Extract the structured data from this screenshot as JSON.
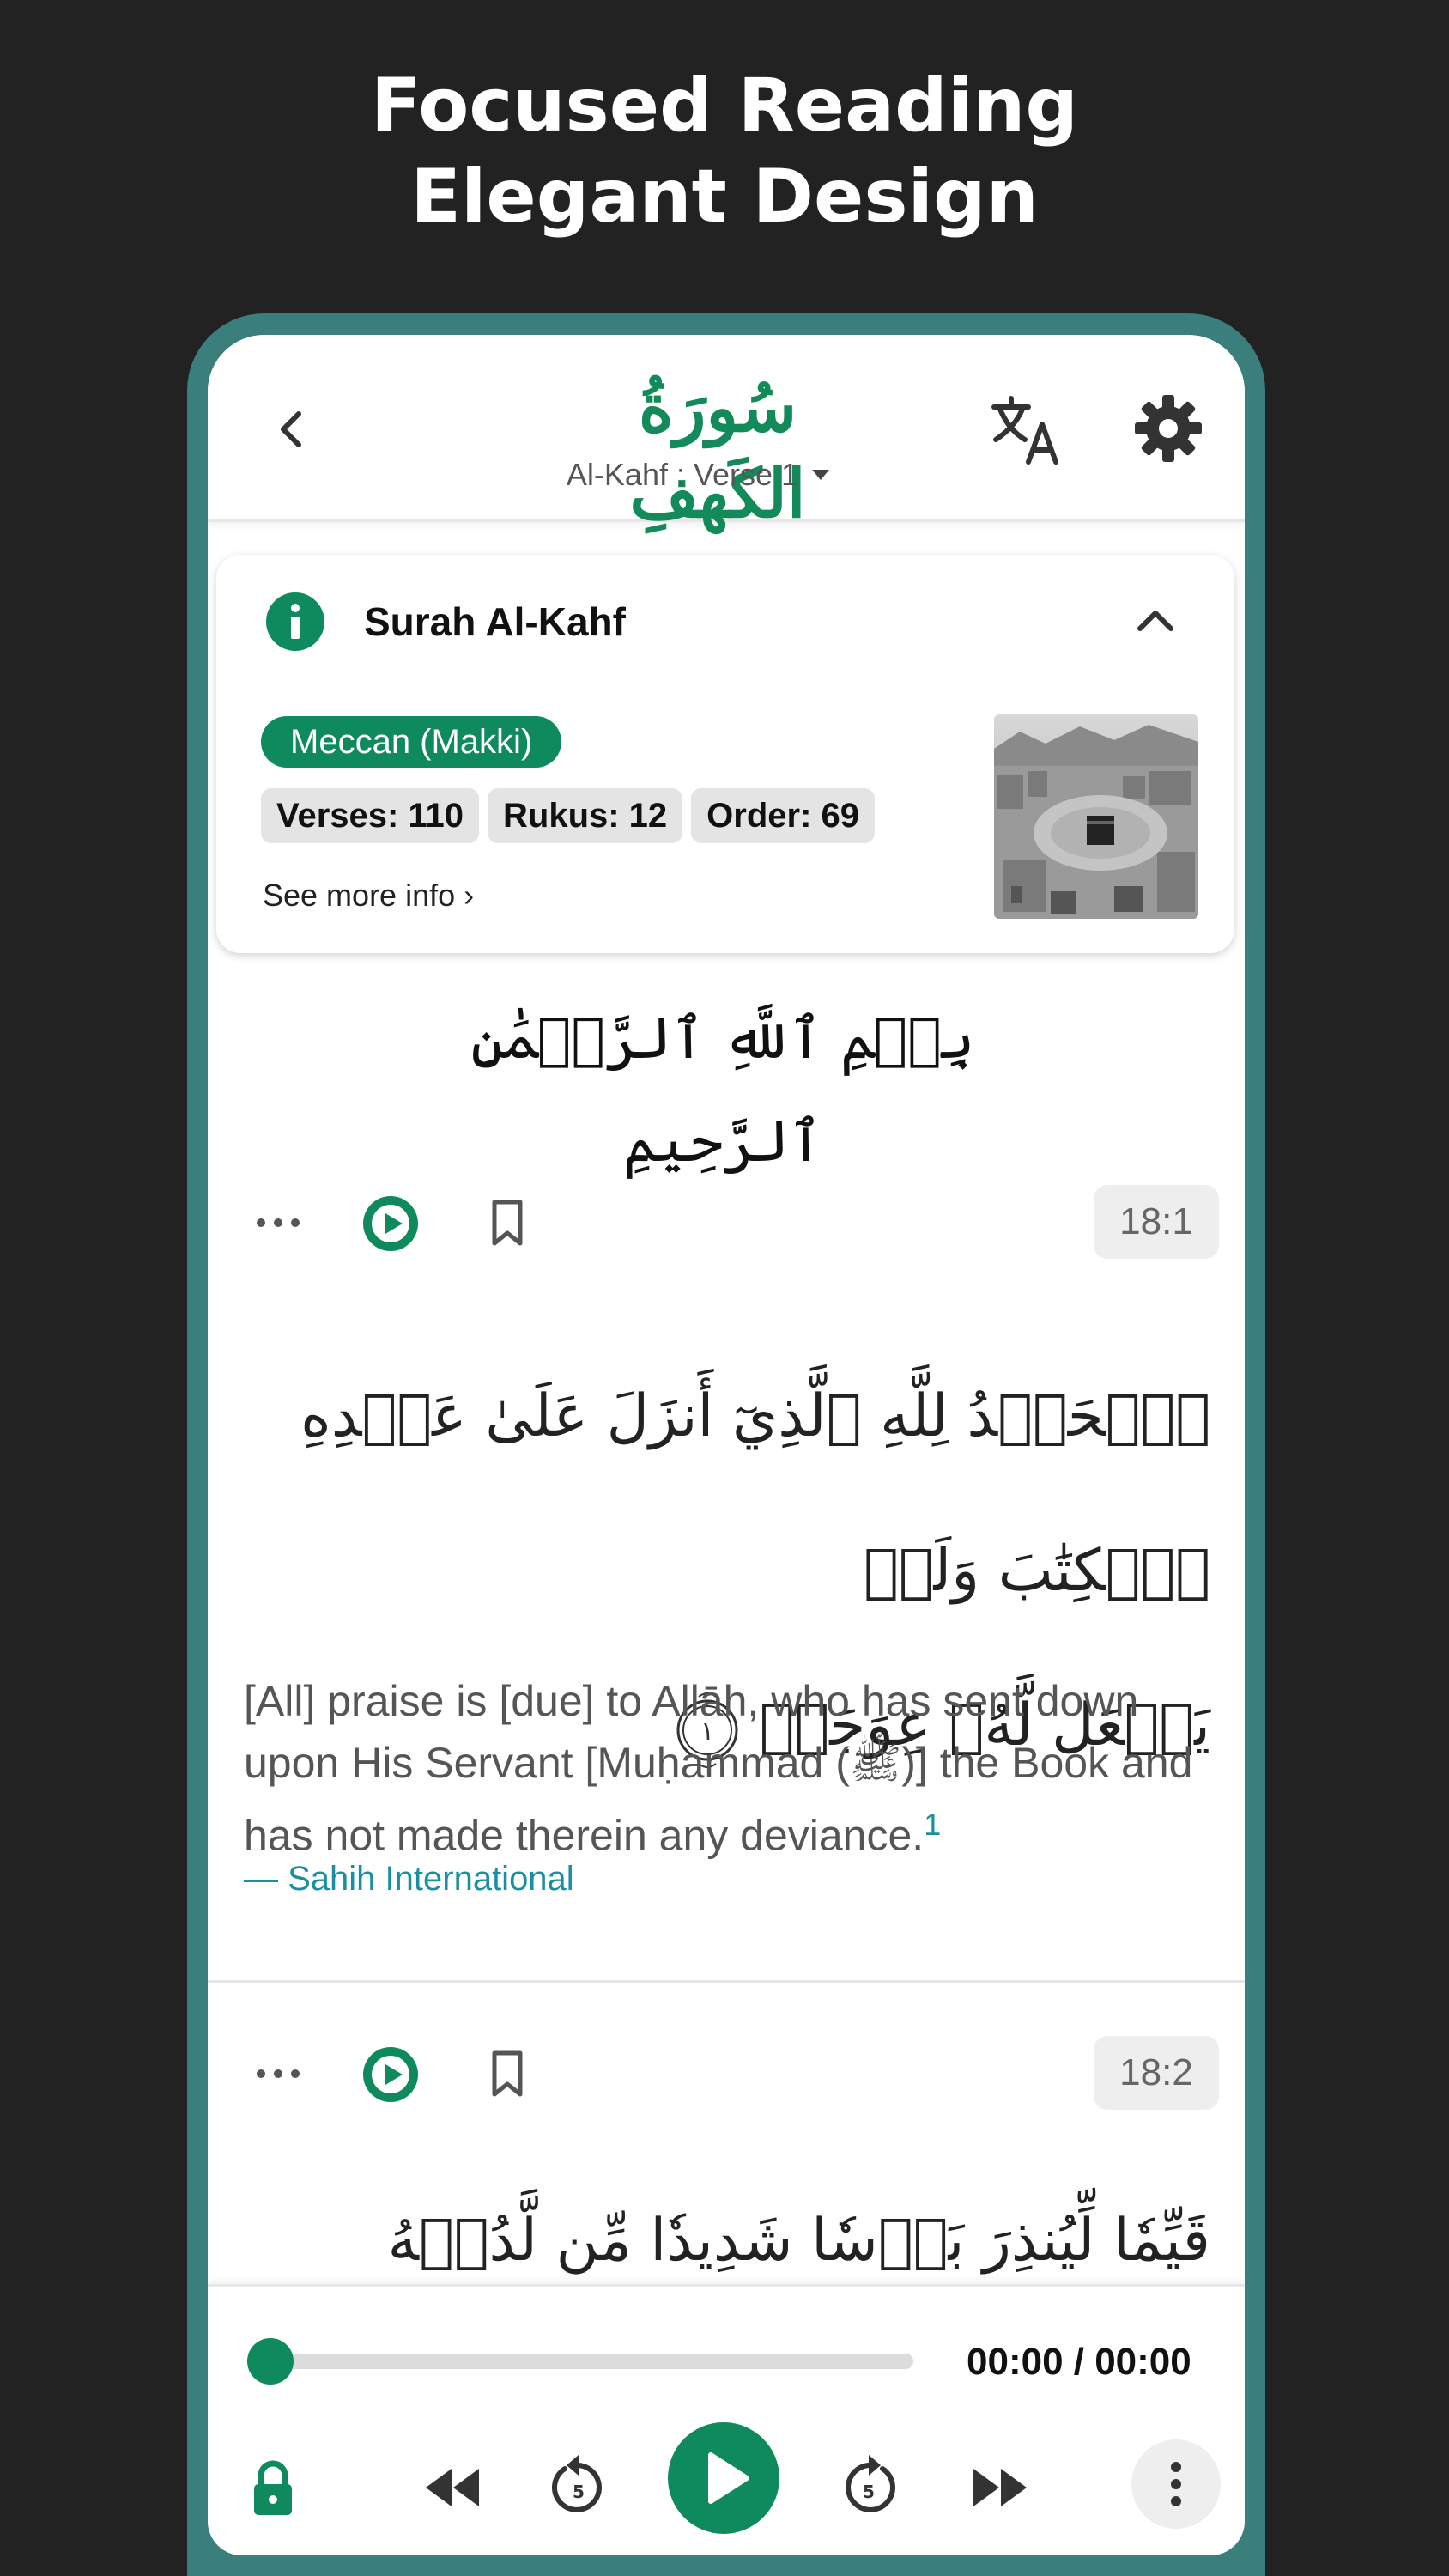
{
  "promo": {
    "line1": "Focused Reading",
    "line2": "Elegant Design"
  },
  "appbar": {
    "surah_name_arabic": "سُورَةُ الكَهفِ",
    "verse_selector": "Al-Kahf : Verse 1",
    "icons": [
      "chevron-left-icon",
      "translate-icon",
      "gear-icon",
      "caret-down-icon"
    ]
  },
  "info_card": {
    "title": "Surah Al-Kahf",
    "revelation": "Meccan (Makki)",
    "stats": [
      "Verses: 110",
      "Rukus: 12",
      "Order: 69"
    ],
    "see_more": "See more info ›",
    "icons": [
      "info-icon",
      "chevron-up-icon"
    ]
  },
  "bismillah": "بِسۡمِ ٱللَّهِ ٱلرَّحۡمَٰنِ ٱلرَّحِيمِ",
  "verses": [
    {
      "key": "18:1",
      "arabic_line1": "ٱلۡحَمۡدُ لِلَّهِ ٱلَّذِيٓ أَنزَلَ عَلَىٰ عَبۡدِهِ ٱلۡكِتَٰبَ وَلَمۡ",
      "arabic_line2": "يَجۡعَل لَّهُۥ عِوَجَاۜ",
      "ayah_number": "١",
      "translation": "[All] praise is [due] to Allāh, who has sent down upon His Servant [Muḥammad (ﷺ)] the Book and has not made therein any deviance.",
      "footnote": "1",
      "translator": "— Sahih International"
    },
    {
      "key": "18:2",
      "arabic_line1": "قَيِّمٗا لِّيُنذِرَ بَأۡسٗا شَدِيدٗا مِّن لَّدُنۡهُ وَيُبَشِّرَ"
    }
  ],
  "player": {
    "time": "00:00 / 00:00",
    "progress": 0,
    "skip_seconds": "5"
  },
  "colors": {
    "accent": "#0f8a5c",
    "frame": "#3a7f7b",
    "background": "#222222",
    "link": "#1a8fa0"
  }
}
